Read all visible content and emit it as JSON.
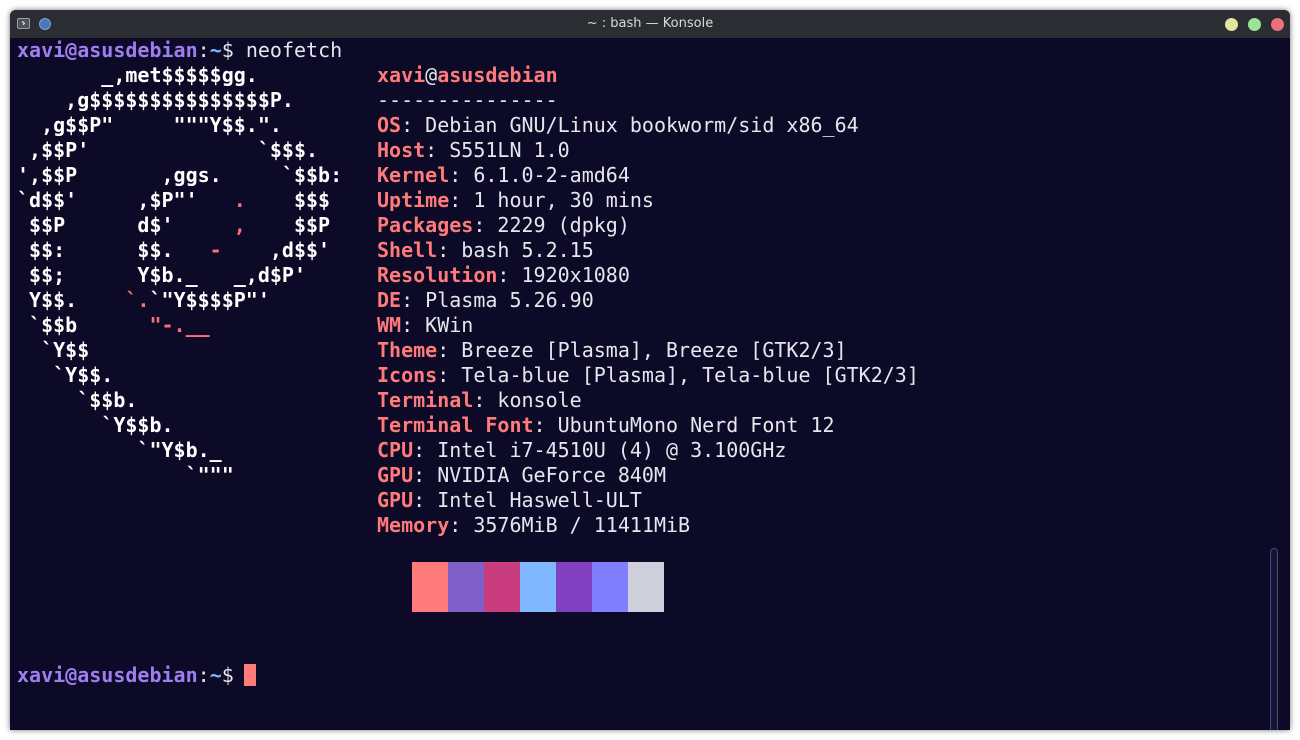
{
  "window": {
    "title": "~ : bash — Konsole",
    "icons": {
      "app": "terminal-icon",
      "pin": "pin-icon",
      "minimize": "minimize-icon",
      "maximize": "maximize-icon",
      "close": "close-icon"
    }
  },
  "prompt": {
    "user": "xavi",
    "at": "@",
    "host": "asusdebian",
    "colon": ":",
    "path": "~",
    "dollar": "$",
    "command": " neofetch"
  },
  "logo": [
    [
      "       _,met$$$$$gg.",
      "",
      ""
    ],
    [
      "    ,g$$$$$$$$$$$$$$$P.",
      "",
      ""
    ],
    [
      "  ,g$$P\"     \"\"\"Y$$.\".",
      "",
      ""
    ],
    [
      " ,$$P'              `$$$.",
      "",
      ""
    ],
    [
      "',$$P       ,ggs.     `$$b:",
      "",
      ""
    ],
    [
      "`d$$'     ,$P\"'   ",
      ".",
      "    $$$"
    ],
    [
      " $$P      d$'     ",
      ",",
      "    $$P"
    ],
    [
      " $$:      $$.   ",
      "-",
      "    ,d$$'"
    ],
    [
      " $$;      Y$b._   _,d$P'",
      "",
      ""
    ],
    [
      " Y$$.    ",
      "`.",
      "`\"Y$$$$P\"'"
    ],
    [
      " `$$b      ",
      "\"-.__",
      ""
    ],
    [
      "  `Y$$",
      "",
      ""
    ],
    [
      "   `Y$$.",
      "",
      ""
    ],
    [
      "     `$$b.",
      "",
      ""
    ],
    [
      "       `Y$$b.",
      "",
      ""
    ],
    [
      "          `\"Y$b._",
      "",
      ""
    ],
    [
      "              `\"\"\"",
      "",
      ""
    ]
  ],
  "info": {
    "user": "xavi",
    "at": "@",
    "host": "asusdebian",
    "separator": "---------------",
    "rows": [
      {
        "key": "OS",
        "value": ": Debian GNU/Linux bookworm/sid x86_64"
      },
      {
        "key": "Host",
        "value": ": S551LN 1.0"
      },
      {
        "key": "Kernel",
        "value": ": 6.1.0-2-amd64"
      },
      {
        "key": "Uptime",
        "value": ": 1 hour, 30 mins"
      },
      {
        "key": "Packages",
        "value": ": 2229 (dpkg)"
      },
      {
        "key": "Shell",
        "value": ": bash 5.2.15"
      },
      {
        "key": "Resolution",
        "value": ": 1920x1080"
      },
      {
        "key": "DE",
        "value": ": Plasma 5.26.90"
      },
      {
        "key": "WM",
        "value": ": KWin"
      },
      {
        "key": "Theme",
        "value": ": Breeze [Plasma], Breeze [GTK2/3]"
      },
      {
        "key": "Icons",
        "value": ": Tela-blue [Plasma], Tela-blue [GTK2/3]"
      },
      {
        "key": "Terminal",
        "value": ": konsole"
      },
      {
        "key": "Terminal Font",
        "value": ": UbuntuMono Nerd Font 12"
      },
      {
        "key": "CPU",
        "value": ": Intel i7-4510U (4) @ 3.100GHz"
      },
      {
        "key": "GPU",
        "value": ": NVIDIA GeForce 840M"
      },
      {
        "key": "GPU",
        "value": ": Intel Haswell-ULT"
      },
      {
        "key": "Memory",
        "value": ": 3576MiB / 11411MiB"
      }
    ]
  },
  "palette": [
    "#ff7b7b",
    "#8060c8",
    "#c93c7e",
    "#7fb8ff",
    "#8040c0",
    "#7f7fff",
    "#cfcfdc"
  ],
  "colors": {
    "background": "#0c0a26",
    "accent_red": "#ff7b7b",
    "prompt_purple": "#9d7ff2",
    "path_blue": "#7fb5ff"
  }
}
